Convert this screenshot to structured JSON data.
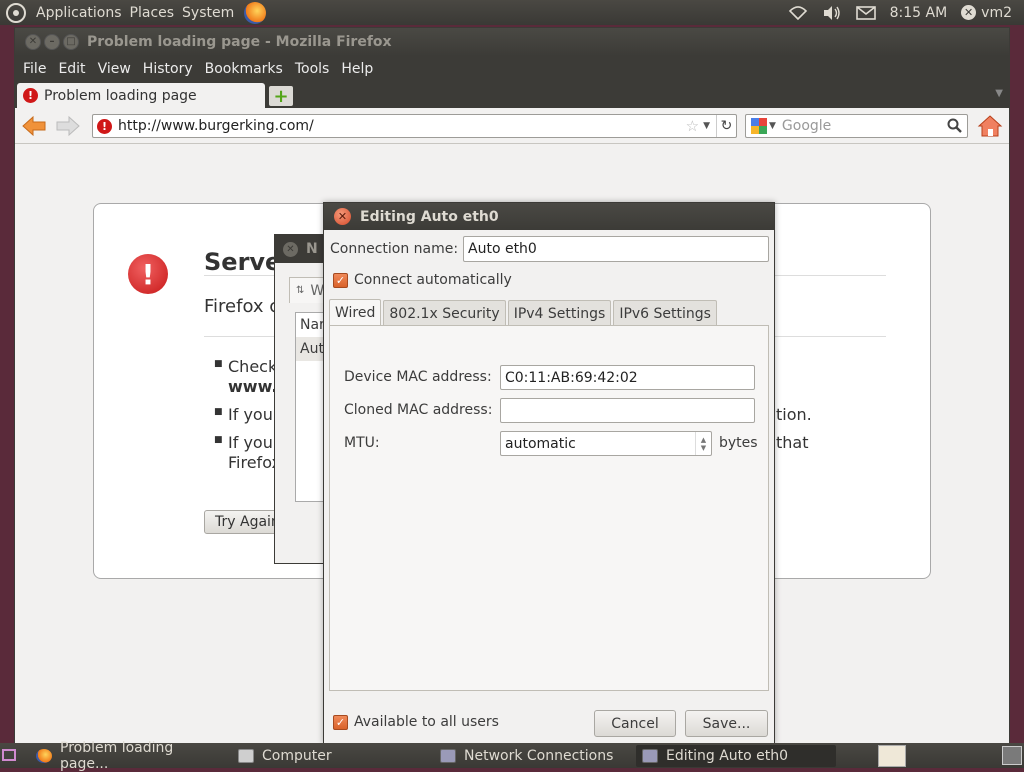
{
  "top_panel": {
    "menus": [
      "Applications",
      "Places",
      "System"
    ],
    "clock": "8:15 AM",
    "user": "vm2"
  },
  "firefox": {
    "title": "Problem loading page - Mozilla Firefox",
    "menu": [
      "File",
      "Edit",
      "View",
      "History",
      "Bookmarks",
      "Tools",
      "Help"
    ],
    "tab_title": "Problem loading page",
    "url": "http://www.burgerking.com/",
    "search_placeholder": "Google",
    "error": {
      "title": "Server",
      "subtitle": "Firefox c",
      "bullets": [
        "Check",
        "www.e",
        "If you a",
        "tion.",
        "If your",
        "that",
        "Firefox"
      ],
      "try_again": "Try Again"
    }
  },
  "network_window": {
    "title_fragment": "N",
    "tab_fragment": "W",
    "col_header": "Nar",
    "row": "Auto"
  },
  "dialog": {
    "title": "Editing Auto eth0",
    "connection_name_label": "Connection name:",
    "connection_name_value": "Auto eth0",
    "connect_auto_label": "Connect automatically",
    "connect_auto_checked": true,
    "tabs": [
      "Wired",
      "802.1x Security",
      "IPv4 Settings",
      "IPv6 Settings"
    ],
    "active_tab": "Wired",
    "device_mac_label": "Device MAC address:",
    "device_mac_value": "C0:11:AB:69:42:02",
    "cloned_mac_label": "Cloned MAC address:",
    "cloned_mac_value": "",
    "mtu_label": "MTU:",
    "mtu_value": "automatic",
    "mtu_unit": "bytes",
    "available_all_label": "Available to all users",
    "available_all_checked": true,
    "cancel_label": "Cancel",
    "save_label": "Save..."
  },
  "taskbar": {
    "items": [
      "Problem loading page...",
      "Computer",
      "Network Connections",
      "Editing Auto eth0"
    ]
  },
  "colors": {
    "accent": "#dd4814",
    "panel": "#3c3b37",
    "error": "#d01818"
  }
}
